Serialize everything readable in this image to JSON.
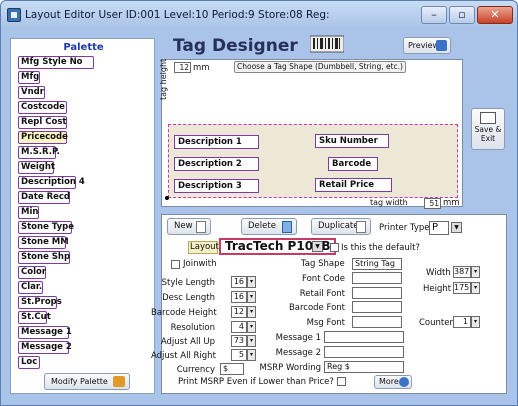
{
  "window": {
    "title": "Layout Editor   User ID:001 Level:10 Period:9 Store:08 Reg:",
    "minimize_glyph": "–",
    "restore_glyph": "▫",
    "close_glyph": "✕"
  },
  "palette": {
    "title": "Palette",
    "items": [
      {
        "label": "Mfg Style No",
        "selected": false
      },
      {
        "label": "Mfg",
        "selected": false
      },
      {
        "label": "Vndr",
        "selected": false
      },
      {
        "label": "Costcode",
        "selected": false
      },
      {
        "label": "Repl Cost",
        "selected": false
      },
      {
        "label": "Pricecode",
        "selected": true
      },
      {
        "label": "M.S.R.P.",
        "selected": false
      },
      {
        "label": "Weight",
        "selected": false
      },
      {
        "label": "Description 4",
        "selected": false
      },
      {
        "label": "Date Recd",
        "selected": false
      },
      {
        "label": "Min",
        "selected": false
      },
      {
        "label": "Stone Type",
        "selected": false
      },
      {
        "label": "Stone MM",
        "selected": false
      },
      {
        "label": "Stone Shp",
        "selected": false
      },
      {
        "label": "Color",
        "selected": false
      },
      {
        "label": "Clar.",
        "selected": false
      },
      {
        "label": "St.Props",
        "selected": false
      },
      {
        "label": "St.Cut",
        "selected": false
      },
      {
        "label": "Message 1",
        "selected": false
      },
      {
        "label": "Message 2",
        "selected": false
      },
      {
        "label": "Loc",
        "selected": false
      }
    ],
    "modify_label": "Modify Palette"
  },
  "designer": {
    "title": "Tag Designer",
    "preview_label": "Preview",
    "ruler_value": "12",
    "ruler_unit": "mm",
    "shape_hint": "Choose a Tag Shape (Dumbbell, String, etc.)",
    "tag_height_label": "tag height",
    "tag_width_label": "tag width",
    "tag_width_value": "51",
    "tag_width_unit": "mm",
    "fields": {
      "description1": "Description 1",
      "description2": "Description 2",
      "description3": "Description 3",
      "sku_number": "Sku Number",
      "barcode": "Barcode",
      "retail_price": "Retail Price"
    },
    "save_exit_label": "Save & Exit"
  },
  "properties": {
    "new_label": "New",
    "delete_label": "Delete",
    "duplicate_label": "Duplicate",
    "printer_type_label": "Printer Type",
    "printer_type_value": "P",
    "layout_label": "Layout",
    "layout_value": "TracTech P100B",
    "default_question": "Is this the default?",
    "joinwith_label": "Joinwith",
    "tag_shape_label": "Tag Shape",
    "tag_shape_value": "String Tag",
    "style_length_label": "Style Length",
    "style_length_value": "16",
    "desc_length_label": "Desc Length",
    "desc_length_value": "16",
    "barcode_height_label": "Barcode Height",
    "barcode_height_value": "12",
    "resolution_label": "Resolution",
    "resolution_value": "4",
    "adjust_all_up_label": "Adjust All Up",
    "adjust_all_up_value": "73",
    "adjust_all_right_label": "Adjust All Right",
    "adjust_all_right_value": "5",
    "currency_label": "Currency",
    "currency_value": "$",
    "font_code_label": "Font Code",
    "retail_font_label": "Retail Font",
    "barcode_font_label": "Barcode Font",
    "msg_font_label": "Msg Font",
    "message1_label": "Message 1",
    "message2_label": "Message 2",
    "msrp_wording_label": "MSRP Wording",
    "msrp_wording_value": "Reg $",
    "print_msrp_label": "Print MSRP Even if Lower than Price?",
    "width_label": "Width",
    "width_value": "387",
    "height_label": "Height",
    "height_value": "175",
    "counter_label": "Counter",
    "counter_value": "1",
    "more_label": "More"
  }
}
